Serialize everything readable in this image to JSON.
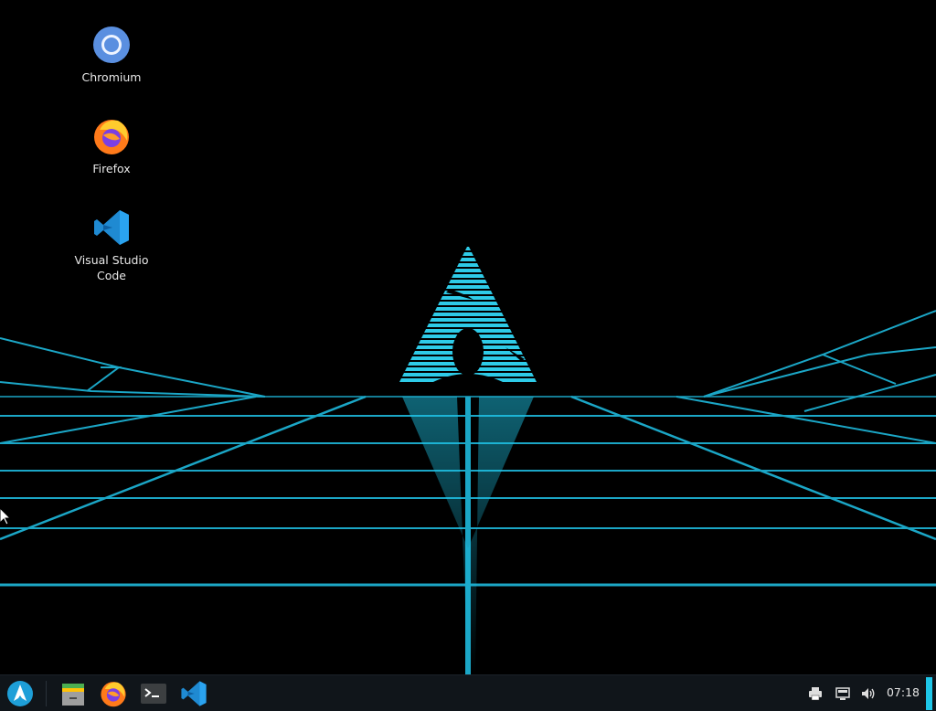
{
  "desktop": {
    "icons": [
      {
        "label": "Chromium",
        "icon": "chromium-icon"
      },
      {
        "label": "Firefox",
        "icon": "firefox-icon"
      },
      {
        "label": "Visual Studio Code",
        "icon": "vscode-icon"
      }
    ]
  },
  "taskbar": {
    "launcher_icon": "arch-logo-icon",
    "pinned": [
      "file-manager-icon",
      "firefox-icon",
      "terminal-icon",
      "vscode-icon"
    ],
    "tray": [
      "printer-icon",
      "network-icon",
      "volume-icon"
    ],
    "clock": "07:18"
  },
  "colors": {
    "accent": "#1ec6e8",
    "background": "#000000",
    "taskbar": "#10151a"
  }
}
